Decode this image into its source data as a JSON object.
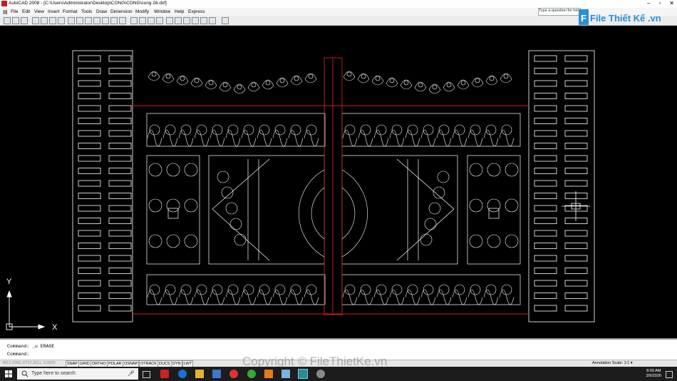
{
  "title": "AutoCAD 2008 - [C:\\Users\\Administrator\\Desktop\\CONG\\CONG\\cong 28.dxf]",
  "search_placeholder": "Type a question for help",
  "logo_text": "File Thiết Kế .vn",
  "menu": [
    "File",
    "Edit",
    "View",
    "Insert",
    "Format",
    "Tools",
    "Draw",
    "Dimension",
    "Modify",
    "Window",
    "Help",
    "Express"
  ],
  "axis": {
    "x": "X",
    "y": "Y"
  },
  "commands": [
    "Command: _u ERASE",
    "Command:"
  ],
  "coords": "4813.2980, 6713.3011, 0.0000",
  "status_buttons": [
    "SNAP",
    "GRID",
    "ORTHO",
    "POLAR",
    "OSNAP",
    "OTRACK",
    "DUCS",
    "DYN",
    "LWT"
  ],
  "annotation_scale": "Annotation Scale: 1:1 ▾",
  "watermark": "Copyright © FileThietKe.vn",
  "taskbar": {
    "search": "Type here to search",
    "time": "8:00 AM",
    "date": "2/9/2020"
  },
  "colors": {
    "canvas": "#000000",
    "lines": "#ffffff",
    "accent_lines": "#cc2222",
    "logo": "#2a8fd8"
  }
}
